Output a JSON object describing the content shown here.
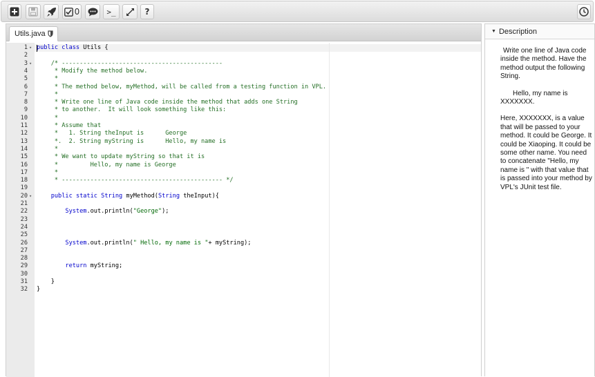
{
  "toolbar": {
    "buttons": [
      {
        "name": "new-file-button",
        "icon": "plus-square-icon",
        "label": ""
      },
      {
        "name": "save-button",
        "icon": "floppy-disk-icon",
        "label": ""
      },
      {
        "name": "run-button",
        "icon": "rocket-icon",
        "label": ""
      },
      {
        "name": "evaluate-button",
        "icon": "checkbox-icon",
        "label": "0"
      },
      {
        "name": "debug-button",
        "icon": "speech-bubble-icon",
        "label": ""
      },
      {
        "name": "console-button",
        "icon": "terminal-icon",
        "label": ">_"
      },
      {
        "name": "fullscreen-button",
        "icon": "expand-arrows-icon",
        "label": ""
      },
      {
        "name": "help-button",
        "icon": "question-icon",
        "label": "?"
      }
    ],
    "timer_icon": "clock-icon"
  },
  "tabs": [
    {
      "label": "Utils.java",
      "icon": "shield-icon",
      "active": true
    }
  ],
  "editor": {
    "cursor_line": 1,
    "lines": [
      {
        "n": "1",
        "fold": true,
        "tokens": [
          {
            "t": "keyword",
            "v": "public"
          },
          {
            "t": "plain",
            "v": " "
          },
          {
            "t": "keyword",
            "v": "class"
          },
          {
            "t": "plain",
            "v": " Utils {"
          }
        ]
      },
      {
        "n": "2",
        "fold": false,
        "tokens": []
      },
      {
        "n": "3",
        "fold": true,
        "tokens": [
          {
            "t": "plain",
            "v": "    "
          },
          {
            "t": "comment",
            "v": "/* ---------------------------------------------"
          }
        ]
      },
      {
        "n": "4",
        "fold": false,
        "tokens": [
          {
            "t": "comment",
            "v": "     * Modify the method below."
          }
        ]
      },
      {
        "n": "5",
        "fold": false,
        "tokens": [
          {
            "t": "comment",
            "v": "     *"
          }
        ]
      },
      {
        "n": "6",
        "fold": false,
        "tokens": [
          {
            "t": "comment",
            "v": "     * The method below, myMethod, will be called from a testing function in VPL."
          }
        ]
      },
      {
        "n": "7",
        "fold": false,
        "tokens": [
          {
            "t": "comment",
            "v": "     *"
          }
        ]
      },
      {
        "n": "8",
        "fold": false,
        "tokens": [
          {
            "t": "comment",
            "v": "     * Write one line of Java code inside the method that adds one String"
          }
        ]
      },
      {
        "n": "9",
        "fold": false,
        "tokens": [
          {
            "t": "comment",
            "v": "     * to another.  It will look something like this:"
          }
        ]
      },
      {
        "n": "10",
        "fold": false,
        "tokens": [
          {
            "t": "comment",
            "v": "     *"
          }
        ]
      },
      {
        "n": "11",
        "fold": false,
        "tokens": [
          {
            "t": "comment",
            "v": "     * Assume that"
          }
        ]
      },
      {
        "n": "12",
        "fold": false,
        "tokens": [
          {
            "t": "comment",
            "v": "     *   1. String theInput is      George"
          }
        ]
      },
      {
        "n": "13",
        "fold": false,
        "tokens": [
          {
            "t": "comment",
            "v": "     *.  2. String myString is      Hello, my name is"
          }
        ]
      },
      {
        "n": "14",
        "fold": false,
        "tokens": [
          {
            "t": "comment",
            "v": "     *"
          }
        ]
      },
      {
        "n": "15",
        "fold": false,
        "tokens": [
          {
            "t": "comment",
            "v": "     * We want to update myString so that it is"
          }
        ]
      },
      {
        "n": "16",
        "fold": false,
        "tokens": [
          {
            "t": "comment",
            "v": "     *         Hello, my name is George"
          }
        ]
      },
      {
        "n": "17",
        "fold": false,
        "tokens": [
          {
            "t": "comment",
            "v": "     *"
          }
        ]
      },
      {
        "n": "18",
        "fold": false,
        "tokens": [
          {
            "t": "comment",
            "v": "     * --------------------------------------------- */"
          }
        ]
      },
      {
        "n": "19",
        "fold": false,
        "tokens": []
      },
      {
        "n": "20",
        "fold": true,
        "tokens": [
          {
            "t": "plain",
            "v": "    "
          },
          {
            "t": "keyword",
            "v": "public"
          },
          {
            "t": "plain",
            "v": " "
          },
          {
            "t": "keyword",
            "v": "static"
          },
          {
            "t": "plain",
            "v": " "
          },
          {
            "t": "type",
            "v": "String"
          },
          {
            "t": "plain",
            "v": " myMethod("
          },
          {
            "t": "type",
            "v": "String"
          },
          {
            "t": "plain",
            "v": " theInput){"
          }
        ]
      },
      {
        "n": "21",
        "fold": false,
        "tokens": []
      },
      {
        "n": "22",
        "fold": false,
        "tokens": [
          {
            "t": "plain",
            "v": "        "
          },
          {
            "t": "type",
            "v": "System"
          },
          {
            "t": "plain",
            "v": ".out.println("
          },
          {
            "t": "string",
            "v": "\"George\""
          },
          {
            "t": "plain",
            "v": ");"
          }
        ]
      },
      {
        "n": "23",
        "fold": false,
        "tokens": []
      },
      {
        "n": "24",
        "fold": false,
        "tokens": []
      },
      {
        "n": "25",
        "fold": false,
        "tokens": []
      },
      {
        "n": "26",
        "fold": false,
        "tokens": [
          {
            "t": "plain",
            "v": "        "
          },
          {
            "t": "type",
            "v": "System"
          },
          {
            "t": "plain",
            "v": ".out.println("
          },
          {
            "t": "string",
            "v": "\" Hello, my name is \""
          },
          {
            "t": "plain",
            "v": "+ myString);"
          }
        ]
      },
      {
        "n": "27",
        "fold": false,
        "tokens": []
      },
      {
        "n": "28",
        "fold": false,
        "tokens": []
      },
      {
        "n": "29",
        "fold": false,
        "tokens": [
          {
            "t": "plain",
            "v": "        "
          },
          {
            "t": "keyword",
            "v": "return"
          },
          {
            "t": "plain",
            "v": " myString;"
          }
        ]
      },
      {
        "n": "30",
        "fold": false,
        "tokens": []
      },
      {
        "n": "31",
        "fold": false,
        "tokens": [
          {
            "t": "plain",
            "v": "    }"
          }
        ]
      },
      {
        "n": "32",
        "fold": false,
        "tokens": [
          {
            "t": "plain",
            "v": "}"
          }
        ]
      }
    ]
  },
  "description": {
    "title": "Description",
    "paragraphs": [
      "Write one line of Java code inside the method.  Have the method output the following String.",
      "Hello, my name is XXXXXXX.",
      "Here, XXXXXXX, is a value that will be passed to your method.  It could be George.  It could be Xiaoping.  It could be some other name.  You need to concatenate \"Hello, my name is \" with that value that is passed into your method by VPL's JUnit test file."
    ]
  },
  "colors": {
    "keyword": "#0000cc",
    "comment": "#236e24",
    "string": "#036a07",
    "gutter": "#ebebeb"
  }
}
